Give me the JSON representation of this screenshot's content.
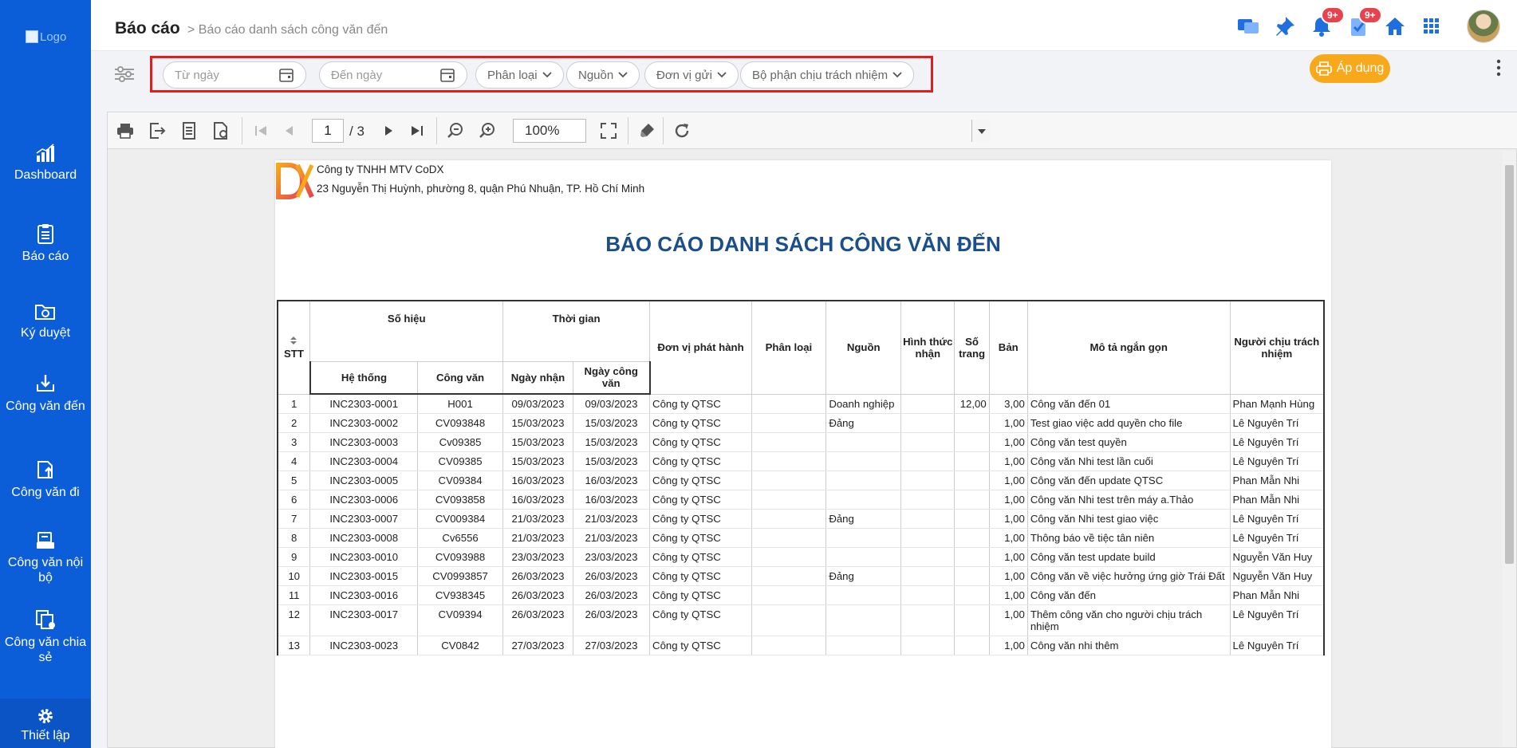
{
  "sidebar": {
    "logo_alt": "Logo",
    "items": [
      {
        "label": "Dashboard",
        "icon": "bar-chart-icon"
      },
      {
        "label": "Báo cáo",
        "icon": "clipboard-icon"
      },
      {
        "label": "Ký duyệt",
        "icon": "folder-sign-icon"
      },
      {
        "label": "Công văn đến",
        "icon": "inbox-download-icon"
      },
      {
        "label": "Công văn đi",
        "icon": "outbox-upload-icon"
      },
      {
        "label": "Công văn nội bộ",
        "icon": "internal-docs-icon"
      },
      {
        "label": "Công văn chia sẻ",
        "icon": "shared-docs-icon"
      }
    ],
    "settings_label": "Thiết lập"
  },
  "header": {
    "title": "Báo cáo",
    "breadcrumb": "> Báo cáo danh sách công văn đến",
    "notification_badge": "9+",
    "task_badge": "9+"
  },
  "filters": {
    "from_date": "Từ ngày",
    "to_date": "Đến ngày",
    "category": "Phân loại",
    "source": "Nguồn",
    "sender_unit": "Đơn vị gửi",
    "responsible_dept": "Bộ phận chịu trách nhiệm",
    "apply_label": "Áp dụng"
  },
  "viewer": {
    "current_page": "1",
    "total_pages": "/ 3",
    "zoom": "100%"
  },
  "report": {
    "company_name": "Công ty TNHH MTV CoDX",
    "company_address": "23 Nguyễn Thị Huỳnh, phường 8, quận Phú Nhuận, TP. Hồ Chí Minh",
    "title": "BÁO CÁO DANH SÁCH CÔNG VĂN ĐẾN",
    "headers": {
      "stt": "STT",
      "so_hieu": "Số hiệu",
      "he_thong": "Hệ thống",
      "cong_van": "Công văn",
      "thoi_gian": "Thời gian",
      "ngay_nhan": "Ngày nhận",
      "ngay_cong_van": "Ngày công văn",
      "don_vi": "Đơn vị phát hành",
      "phan_loai": "Phân loại",
      "nguon": "Nguồn",
      "hinh_thuc": "Hình thức nhận",
      "so_trang": "Số trang",
      "ban": "Bản",
      "mo_ta": "Mô tả ngắn gọn",
      "nguoi": "Người chịu trách nhiệm"
    },
    "rows": [
      {
        "stt": "1",
        "he_thong": "INC2303-0001",
        "cong_van": "H001",
        "ngay_nhan": "09/03/2023",
        "ngay_cv": "09/03/2023",
        "don_vi": "Công ty QTSC",
        "phan_loai": "",
        "nguon": "Doanh nghiệp",
        "hinh_thuc": "",
        "so_trang": "12,00",
        "ban": "3,00",
        "mo_ta": "Công văn đến 01",
        "nguoi": "Phan Mạnh Hùng"
      },
      {
        "stt": "2",
        "he_thong": "INC2303-0002",
        "cong_van": "CV093848",
        "ngay_nhan": "15/03/2023",
        "ngay_cv": "15/03/2023",
        "don_vi": "Công ty QTSC",
        "phan_loai": "",
        "nguon": "Đảng",
        "hinh_thuc": "",
        "so_trang": "",
        "ban": "1,00",
        "mo_ta": "Test giao việc add quyền cho file",
        "nguoi": "Lê Nguyên Trí"
      },
      {
        "stt": "3",
        "he_thong": "INC2303-0003",
        "cong_van": "Cv09385",
        "ngay_nhan": "15/03/2023",
        "ngay_cv": "15/03/2023",
        "don_vi": "Công ty QTSC",
        "phan_loai": "",
        "nguon": "",
        "hinh_thuc": "",
        "so_trang": "",
        "ban": "1,00",
        "mo_ta": "Công văn test quyền",
        "nguoi": "Lê Nguyên Trí"
      },
      {
        "stt": "4",
        "he_thong": "INC2303-0004",
        "cong_van": "CV09385",
        "ngay_nhan": "15/03/2023",
        "ngay_cv": "15/03/2023",
        "don_vi": "Công ty QTSC",
        "phan_loai": "",
        "nguon": "",
        "hinh_thuc": "",
        "so_trang": "",
        "ban": "1,00",
        "mo_ta": "Công văn Nhi test lần cuối",
        "nguoi": "Lê Nguyên Trí"
      },
      {
        "stt": "5",
        "he_thong": "INC2303-0005",
        "cong_van": "CV09384",
        "ngay_nhan": "16/03/2023",
        "ngay_cv": "16/03/2023",
        "don_vi": "Công ty QTSC",
        "phan_loai": "",
        "nguon": "",
        "hinh_thuc": "",
        "so_trang": "",
        "ban": "1,00",
        "mo_ta": "Công văn đến update QTSC",
        "nguoi": "Phan Mẫn Nhi"
      },
      {
        "stt": "6",
        "he_thong": "INC2303-0006",
        "cong_van": "CV093858",
        "ngay_nhan": "16/03/2023",
        "ngay_cv": "16/03/2023",
        "don_vi": "Công ty QTSC",
        "phan_loai": "",
        "nguon": "",
        "hinh_thuc": "",
        "so_trang": "",
        "ban": "1,00",
        "mo_ta": "Công văn Nhi test trên máy a.Thảo",
        "nguoi": "Phan Mẫn Nhi"
      },
      {
        "stt": "7",
        "he_thong": "INC2303-0007",
        "cong_van": "CV009384",
        "ngay_nhan": "21/03/2023",
        "ngay_cv": "21/03/2023",
        "don_vi": "Công ty QTSC",
        "phan_loai": "",
        "nguon": "Đảng",
        "hinh_thuc": "",
        "so_trang": "",
        "ban": "1,00",
        "mo_ta": "Công văn Nhi test giao việc",
        "nguoi": "Lê Nguyên Trí"
      },
      {
        "stt": "8",
        "he_thong": "INC2303-0008",
        "cong_van": "Cv6556",
        "ngay_nhan": "21/03/2023",
        "ngay_cv": "21/03/2023",
        "don_vi": "Công ty QTSC",
        "phan_loai": "",
        "nguon": "",
        "hinh_thuc": "",
        "so_trang": "",
        "ban": "1,00",
        "mo_ta": "Thông báo về tiệc tân niên",
        "nguoi": "Lê Nguyên Trí"
      },
      {
        "stt": "9",
        "he_thong": "INC2303-0010",
        "cong_van": "CV093988",
        "ngay_nhan": "23/03/2023",
        "ngay_cv": "23/03/2023",
        "don_vi": "Công ty QTSC",
        "phan_loai": "",
        "nguon": "",
        "hinh_thuc": "",
        "so_trang": "",
        "ban": "1,00",
        "mo_ta": "Công văn test update build",
        "nguoi": "Nguyễn Văn Huy"
      },
      {
        "stt": "10",
        "he_thong": "INC2303-0015",
        "cong_van": "CV0993857",
        "ngay_nhan": "26/03/2023",
        "ngay_cv": "26/03/2023",
        "don_vi": "Công ty QTSC",
        "phan_loai": "",
        "nguon": "Đảng",
        "hinh_thuc": "",
        "so_trang": "",
        "ban": "1,00",
        "mo_ta": "Công văn về việc hưởng ứng giờ Trái Đất",
        "nguoi": "Nguyễn Văn Huy"
      },
      {
        "stt": "11",
        "he_thong": "INC2303-0016",
        "cong_van": "CV938345",
        "ngay_nhan": "26/03/2023",
        "ngay_cv": "26/03/2023",
        "don_vi": "Công ty QTSC",
        "phan_loai": "",
        "nguon": "",
        "hinh_thuc": "",
        "so_trang": "",
        "ban": "1,00",
        "mo_ta": "Công văn đến",
        "nguoi": "Phan Mẫn Nhi"
      },
      {
        "stt": "12",
        "he_thong": "INC2303-0017",
        "cong_van": "CV09394",
        "ngay_nhan": "26/03/2023",
        "ngay_cv": "26/03/2023",
        "don_vi": "Công ty QTSC",
        "phan_loai": "",
        "nguon": "",
        "hinh_thuc": "",
        "so_trang": "",
        "ban": "1,00",
        "mo_ta": "Thêm công văn cho người chịu trách nhiệm",
        "nguoi": "Lê Nguyên Trí"
      },
      {
        "stt": "13",
        "he_thong": "INC2303-0023",
        "cong_van": "CV0842",
        "ngay_nhan": "27/03/2023",
        "ngay_cv": "27/03/2023",
        "don_vi": "Công ty QTSC",
        "phan_loai": "",
        "nguon": "",
        "hinh_thuc": "",
        "so_trang": "",
        "ban": "1,00",
        "mo_ta": "Công văn nhi thêm",
        "nguoi": "Lê Nguyên Trí"
      }
    ]
  },
  "colors": {
    "sidebar": "#0c5ed8",
    "accent_orange": "#f7a81b",
    "title_blue": "#1b4e8c",
    "badge_red": "#e8424f",
    "highlight_red": "#e01e1e"
  }
}
